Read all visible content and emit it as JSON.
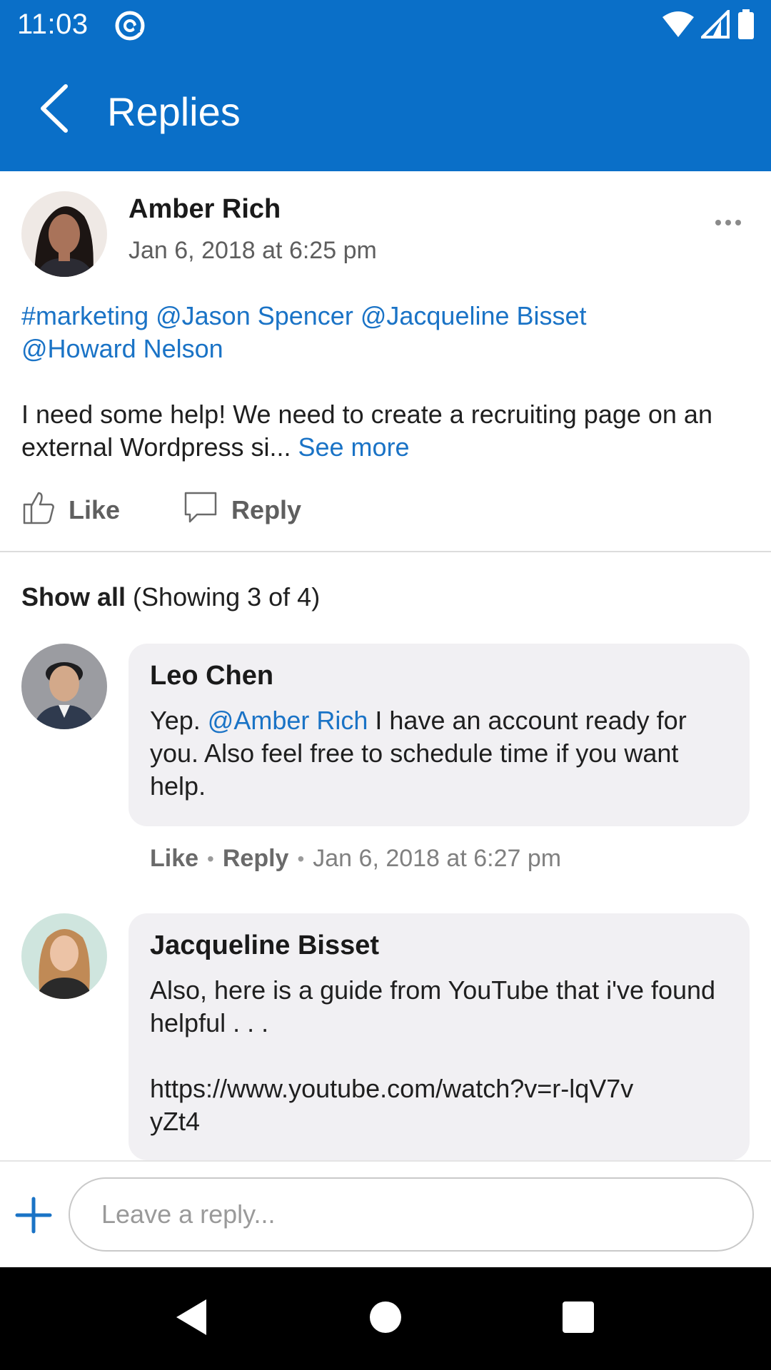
{
  "status_bar": {
    "time": "11:03",
    "app_icon": "at-sign-icon",
    "icons": [
      "wifi-icon",
      "signal-icon",
      "battery-icon"
    ]
  },
  "app_bar": {
    "title": "Replies",
    "back_icon": "chevron-left-icon"
  },
  "post": {
    "author": "Amber Rich",
    "timestamp": "Jan 6, 2018 at 6:25 pm",
    "tags": [
      "#marketing",
      "@Jason Spencer",
      "@Jacqueline Bisset",
      "@Howard Nelson"
    ],
    "body": "I need some help! We need to create a recruiting page on an external Wordpress si...",
    "see_more": "See more",
    "actions": {
      "like": "Like",
      "reply": "Reply"
    }
  },
  "replies_header": {
    "show_all": "Show all",
    "showing": "(Showing 3 of 4)"
  },
  "replies": [
    {
      "author": "Leo Chen",
      "text_prefix": "Yep.",
      "mention": "@Amber Rich",
      "text_suffix": "I have an account ready for you.  Also feel free to schedule time if you want help.",
      "like": "Like",
      "reply": "Reply",
      "timestamp": "Jan 6, 2018 at 6:27 pm"
    },
    {
      "author": "Jacqueline Bisset",
      "text": "Also, here is a guide from YouTube that i've found helpful . . .",
      "link": "https://www.youtube.com/watch?v=r-lqV7vyZt4"
    }
  ],
  "composer": {
    "placeholder": "Leave a reply..."
  },
  "colors": {
    "brand": "#0a6fc8",
    "link": "#1a73c6",
    "bubble": "#f1f0f3"
  }
}
